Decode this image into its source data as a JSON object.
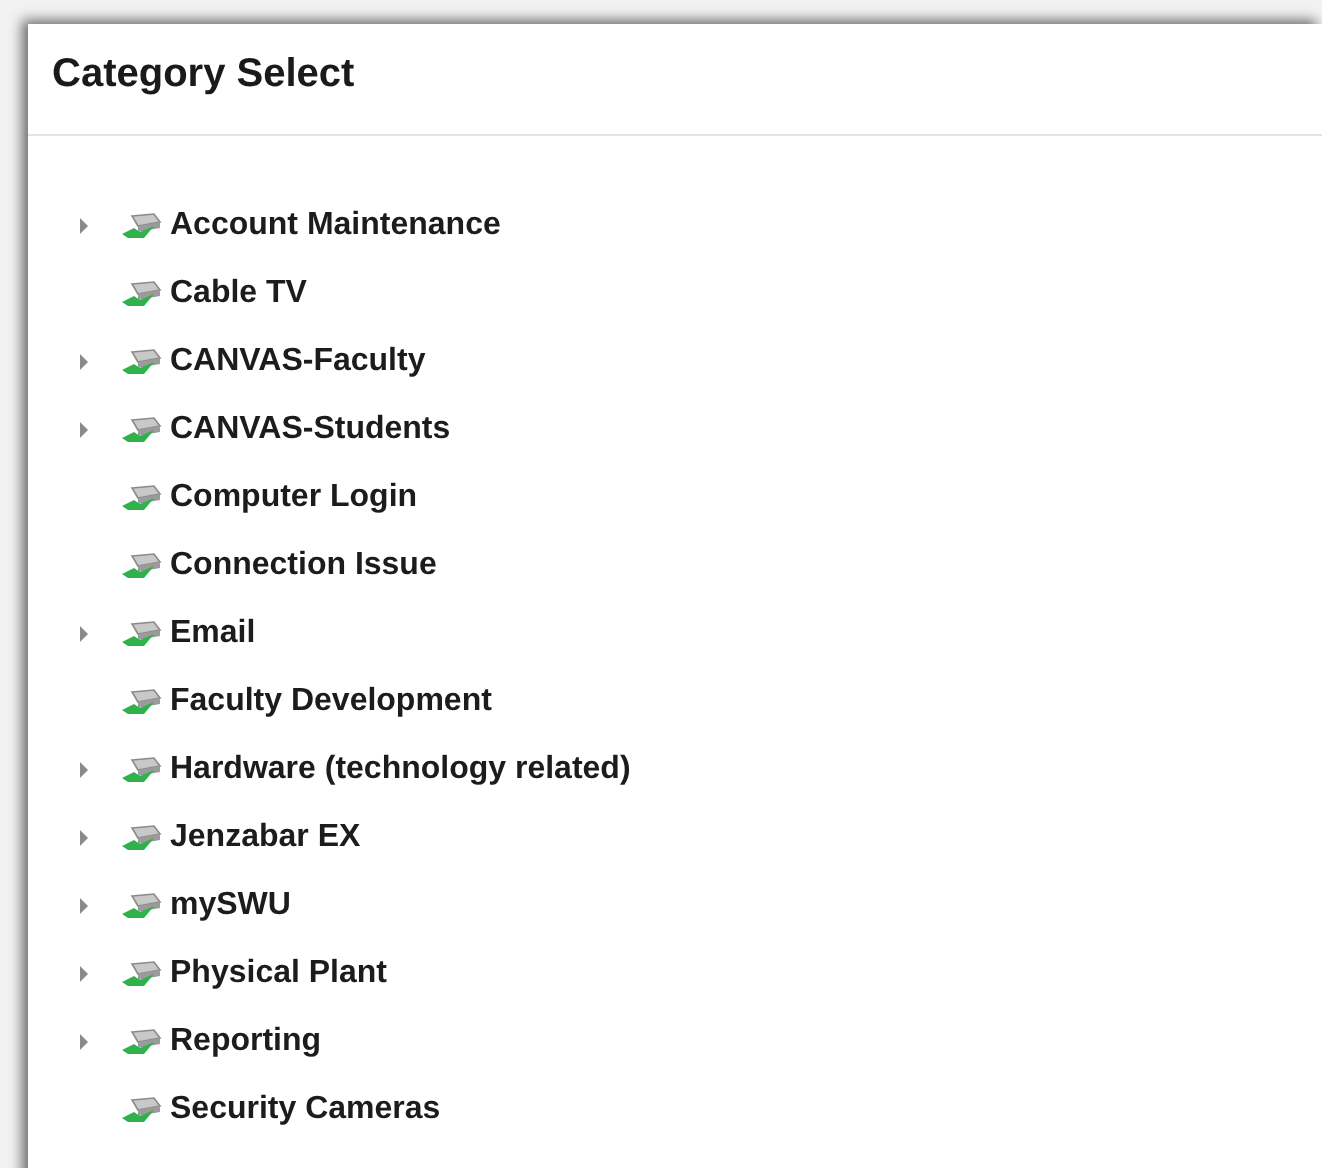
{
  "panel": {
    "title": "Category Select"
  },
  "categories": [
    {
      "label": "Account Maintenance",
      "kind": "branch"
    },
    {
      "label": "Cable TV",
      "kind": "leaf"
    },
    {
      "label": "CANVAS-Faculty",
      "kind": "branch"
    },
    {
      "label": "CANVAS-Students",
      "kind": "branch"
    },
    {
      "label": "Computer Login",
      "kind": "leaf"
    },
    {
      "label": "Connection Issue",
      "kind": "leaf"
    },
    {
      "label": "Email",
      "kind": "branch"
    },
    {
      "label": "Faculty Development",
      "kind": "leaf"
    },
    {
      "label": "Hardware (technology related)",
      "kind": "branch"
    },
    {
      "label": "Jenzabar EX",
      "kind": "branch"
    },
    {
      "label": "mySWU",
      "kind": "branch"
    },
    {
      "label": "Physical Plant",
      "kind": "branch"
    },
    {
      "label": "Reporting",
      "kind": "branch"
    },
    {
      "label": "Security Cameras",
      "kind": "leaf"
    }
  ]
}
